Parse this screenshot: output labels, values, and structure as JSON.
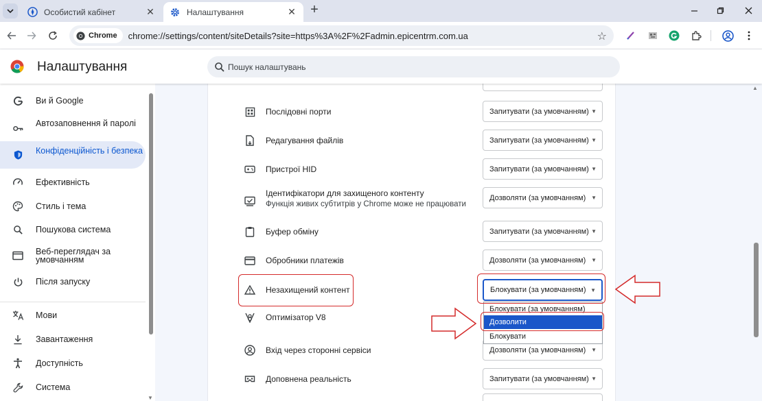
{
  "browser": {
    "tabs": [
      {
        "title": "Особистий кабінет",
        "active": false
      },
      {
        "title": "Налаштування",
        "active": true
      }
    ],
    "chip_label": "Chrome",
    "url": "chrome://settings/content/siteDetails?site=https%3A%2F%2Fadmin.epicentrm.com.ua",
    "icons": [
      "chevron-down-icon",
      "back-icon",
      "forward-icon",
      "reload-icon",
      "star-icon",
      "extensions-icon",
      "profile-icon",
      "menu-dots-icon"
    ]
  },
  "header": {
    "title": "Налаштування",
    "search_placeholder": "Пошук налаштувань"
  },
  "sidebar": {
    "items": [
      {
        "label": "Ви й Google",
        "icon": "google-g-icon"
      },
      {
        "label": "Автозаповнення й паролі",
        "icon": "key-icon"
      },
      {
        "label": "Конфіденційність і безпека",
        "icon": "shield-icon",
        "selected": true
      },
      {
        "label": "Ефективність",
        "icon": "speedometer-icon"
      },
      {
        "label": "Стиль і тема",
        "icon": "palette-icon"
      },
      {
        "label": "Пошукова система",
        "icon": "search-icon"
      },
      {
        "label": "Веб-переглядач за умовчанням",
        "icon": "browser-window-icon"
      },
      {
        "label": "Після запуску",
        "icon": "power-icon"
      },
      {
        "label": "Мови",
        "icon": "translate-icon"
      },
      {
        "label": "Завантаження",
        "icon": "download-icon"
      },
      {
        "label": "Доступність",
        "icon": "accessibility-icon"
      },
      {
        "label": "Система",
        "icon": "wrench-icon"
      }
    ]
  },
  "permissions": [
    {
      "title": "Послідовні порти",
      "value": "Запитувати (за умовчанням)",
      "icon": "serial-port-icon"
    },
    {
      "title": "Редагування файлів",
      "value": "Запитувати (за умовчанням)",
      "icon": "file-edit-icon"
    },
    {
      "title": "Пристрої HID",
      "value": "Запитувати (за умовчанням)",
      "icon": "hid-device-icon"
    },
    {
      "title": "Ідентифікатори для захищеного контенту",
      "subtitle": "Функція живих субтитрів у Chrome може не працювати",
      "value": "Дозволяти (за умовчанням)",
      "icon": "protected-content-icon"
    },
    {
      "title": "Буфер обміну",
      "value": "Запитувати (за умовчанням)",
      "icon": "clipboard-icon"
    },
    {
      "title": "Обробники платежів",
      "value": "Дозволяти (за умовчанням)",
      "icon": "payment-card-icon"
    },
    {
      "title": "Незахищений контент",
      "value": "Блокувати (за умовчанням)",
      "icon": "warning-icon",
      "focused": true
    },
    {
      "title": "Оптимізатор V8",
      "value": "",
      "icon": "v8-icon"
    },
    {
      "title": "Вхід через сторонні сервіси",
      "value": "Дозволяти (за умовчанням)",
      "icon": "account-circle-icon"
    },
    {
      "title": "Доповнена реальність",
      "value": "Запитувати (за умовчанням)",
      "icon": "ar-headset-icon"
    }
  ],
  "dropdown": {
    "options": [
      "Блокувати (за умовчанням)",
      "Дозволити",
      "Блокувати"
    ],
    "highlighted_index": 1
  },
  "colors": {
    "accent": "#0b57d0",
    "annotation_red": "#d42a2a",
    "highlight": "#1a57c9"
  }
}
